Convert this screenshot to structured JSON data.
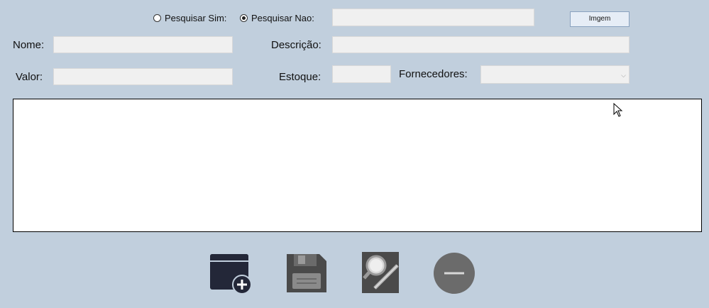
{
  "search": {
    "option_yes": "Pesquisar Sim:",
    "option_no": "Pesquisar Nao:",
    "selected": "no",
    "value": ""
  },
  "image_button": "Imgem",
  "form": {
    "nome_label": "Nome:",
    "nome_value": "",
    "descricao_label": "Descrição:",
    "descricao_value": "",
    "valor_label": "Valor:",
    "valor_value": "",
    "estoque_label": "Estoque:",
    "estoque_value": "",
    "fornecedores_label": "Fornecedores:",
    "fornecedores_value": ""
  },
  "toolbar": {
    "icons": [
      "add-window-icon",
      "save-icon",
      "search-edit-icon",
      "remove-icon"
    ]
  },
  "colors": {
    "background": "#c1cfdd",
    "icon": "#4a4a4a",
    "icon_dark": "#232738"
  }
}
